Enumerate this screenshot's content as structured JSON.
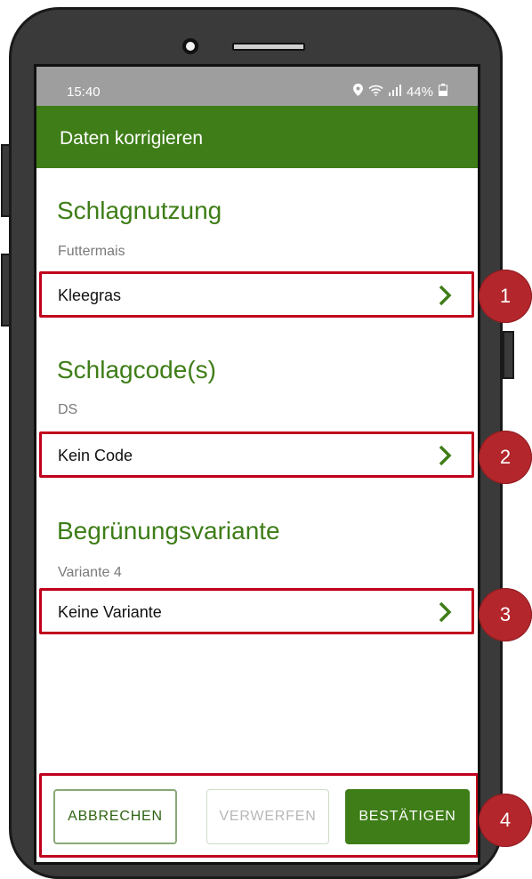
{
  "status": {
    "time": "15:40",
    "battery": "44%"
  },
  "appbar": {
    "title": "Daten korrigieren"
  },
  "sections": [
    {
      "title": "Schlagnutzung",
      "current": "Futtermais",
      "option": "Kleegras",
      "marker": "1"
    },
    {
      "title": "Schlagcode(s)",
      "current": "DS",
      "option": "Kein Code",
      "marker": "2"
    },
    {
      "title": "Begrünungsvariante",
      "current": "Variante 4",
      "option": "Keine Variante",
      "marker": "3"
    }
  ],
  "footer": {
    "cancel": "ABBRECHEN",
    "discard": "VERWERFEN",
    "confirm": "BESTÄTIGEN",
    "marker": "4"
  },
  "colors": {
    "brand": "#3e7d17",
    "highlight": "#c0001c",
    "marker": "#b3262b"
  }
}
